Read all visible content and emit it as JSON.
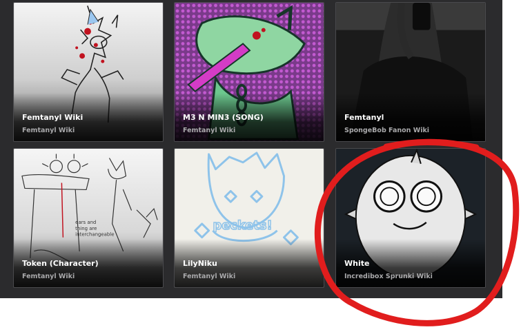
{
  "results": [
    {
      "title": "Femtanyl Wiki",
      "community": "Femtanyl Wiki"
    },
    {
      "title": "M3 N MIN3 (SONG)",
      "community": "Femtanyl Wiki"
    },
    {
      "title": "Femtanyl",
      "community": "SpongeBob Fanon Wiki"
    },
    {
      "title": "Token (Character)",
      "community": "Femtanyl Wiki"
    },
    {
      "title": "LilyNiku",
      "community": "Femtanyl Wiki"
    },
    {
      "title": "White",
      "community": "Incredibox Sprunki Wiki"
    }
  ],
  "thumbnails": {
    "card_5_watermark": "peckets!"
  },
  "colors": {
    "panel": "#2b2b2d",
    "highlight_circle": "#e11d1d"
  }
}
